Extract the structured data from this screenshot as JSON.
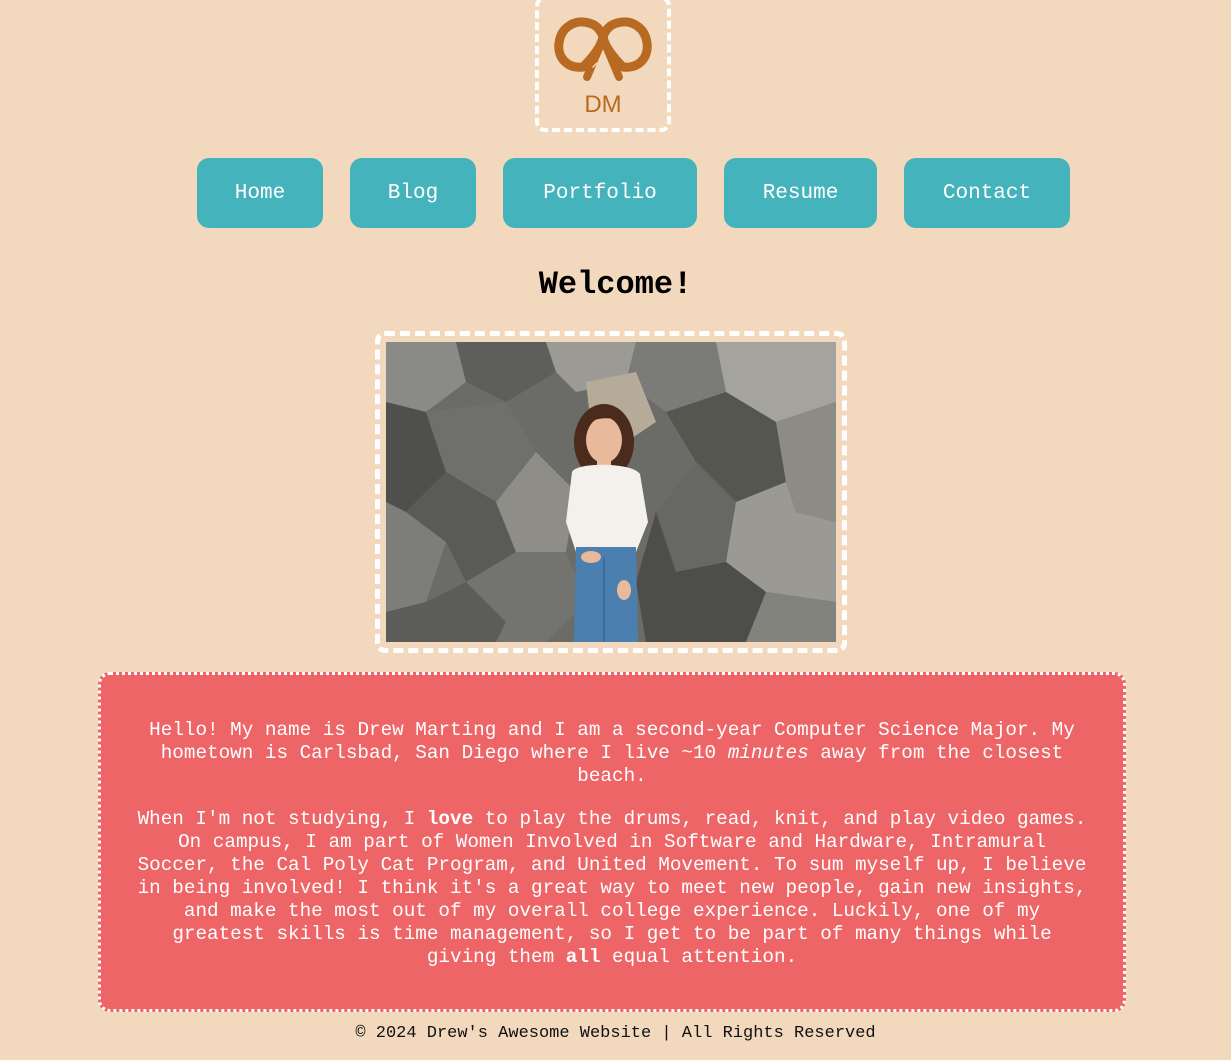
{
  "logo": {
    "initials": "DM",
    "icon": "pretzel-icon",
    "color": "#b86a22"
  },
  "nav": {
    "home": "Home",
    "blog": "Blog",
    "portfolio": "Portfolio",
    "resume": "Resume",
    "contact": "Contact"
  },
  "page": {
    "title": "Welcome!"
  },
  "about": {
    "p1_part1": "Hello! My name is Drew Marting and I am a second-year Computer Science Major. My hometown is Carlsbad, San Diego where I live ~10 ",
    "p1_em": "minutes",
    "p1_part2": " away from the closest beach.",
    "p2_part1": "When I'm not studying, I ",
    "p2_strong1": "love",
    "p2_part2": " to play the drums, read, knit, and play video games. On campus, I am part of Women Involved in Software and Hardware, Intramural Soccer, the Cal Poly Cat Program, and United Movement. To sum myself up, I believe in being involved! I think it's a great way to meet new people, gain new insights, and make the most out of my overall college experience. Luckily, one of my greatest skills is time management, so I get to be part of many things while giving them ",
    "p2_strong2": "all",
    "p2_part3": " equal attention."
  },
  "footer": {
    "text": "© 2024 Drew's Awesome Website | All Rights Reserved"
  },
  "colors": {
    "background": "#f2d9bd",
    "nav_button": "#45b3bc",
    "about_box": "#ee6567",
    "frame_border": "#ffffff"
  }
}
